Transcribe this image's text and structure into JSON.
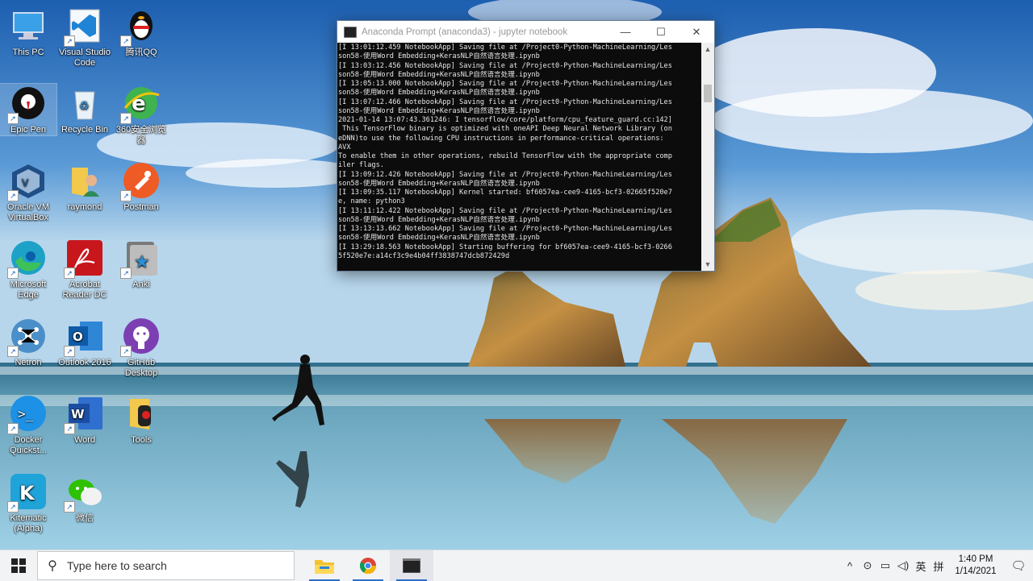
{
  "desktop": {
    "icons": [
      {
        "label": "This PC",
        "icon": "computer-icon"
      },
      {
        "label": "Visual Studio Code",
        "icon": "vscode-icon"
      },
      {
        "label": "腾讯QQ",
        "icon": "qq-penguin-icon"
      },
      {
        "label": "Epic Pen",
        "icon": "epic-pen-icon"
      },
      {
        "label": "Recycle Bin",
        "icon": "recycle-bin-icon"
      },
      {
        "label": "360安全浏览器",
        "icon": "360-browser-icon"
      },
      {
        "label": "Oracle VM VirtualBox",
        "icon": "virtualbox-icon"
      },
      {
        "label": "raymond",
        "icon": "user-folder-icon"
      },
      {
        "label": "Postman",
        "icon": "postman-icon"
      },
      {
        "label": "Microsoft Edge",
        "icon": "edge-icon"
      },
      {
        "label": "Acrobat Reader DC",
        "icon": "acrobat-icon"
      },
      {
        "label": "Anki",
        "icon": "anki-icon"
      },
      {
        "label": "Netron",
        "icon": "netron-icon"
      },
      {
        "label": "Outlook 2016",
        "icon": "outlook-icon"
      },
      {
        "label": "GitHub Desktop",
        "icon": "github-icon"
      },
      {
        "label": "Docker Quickst...",
        "icon": "docker-icon"
      },
      {
        "label": "Word",
        "icon": "word-icon"
      },
      {
        "label": "Tools",
        "icon": "tools-folder-icon"
      },
      {
        "label": "Kitematic (Alpha)",
        "icon": "kitematic-icon"
      },
      {
        "label": "微信",
        "icon": "wechat-icon"
      }
    ]
  },
  "window": {
    "title": "Anaconda Prompt (anaconda3) - jupyter  notebook",
    "minimize": "—",
    "maximize": "☐",
    "close": "✕",
    "console_lines": [
      "[I 13:01:12.459 NotebookApp] Saving file at /Project0-Python-MachineLearning/Les",
      "son58-使用Word Embedding+KerasNLP自然语言处理.ipynb",
      "[I 13:03:12.456 NotebookApp] Saving file at /Project0-Python-MachineLearning/Les",
      "son58-使用Word Embedding+KerasNLP自然语言处理.ipynb",
      "[I 13:05:13.000 NotebookApp] Saving file at /Project0-Python-MachineLearning/Les",
      "son58-使用Word Embedding+KerasNLP自然语言处理.ipynb",
      "[I 13:07:12.466 NotebookApp] Saving file at /Project0-Python-MachineLearning/Les",
      "son58-使用Word Embedding+KerasNLP自然语言处理.ipynb",
      "2021-01-14 13:07:43.361246: I tensorflow/core/platform/cpu_feature_guard.cc:142]",
      " This TensorFlow binary is optimized with oneAPI Deep Neural Network Library (on",
      "eDNN)to use the following CPU instructions in performance-critical operations:",
      "AVX",
      "To enable them in other operations, rebuild TensorFlow with the appropriate comp",
      "iler flags.",
      "[I 13:09:12.426 NotebookApp] Saving file at /Project0-Python-MachineLearning/Les",
      "son58-使用Word Embedding+KerasNLP自然语言处理.ipynb",
      "[I 13:09:35.117 NotebookApp] Kernel started: bf6057ea-cee9-4165-bcf3-02665f520e7",
      "e, name: python3",
      "[I 13:11:12.422 NotebookApp] Saving file at /Project0-Python-MachineLearning/Les",
      "son58-使用Word Embedding+KerasNLP自然语言处理.ipynb",
      "[I 13:13:13.662 NotebookApp] Saving file at /Project0-Python-MachineLearning/Les",
      "son58-使用Word Embedding+KerasNLP自然语言处理.ipynb",
      "[I 13:29:18.563 NotebookApp] Starting buffering for bf6057ea-cee9-4165-bcf3-0266",
      "5f520e7e:a14cf3c9e4b04ff3838747dcb872429d"
    ]
  },
  "taskbar": {
    "search_placeholder": "Type here to search",
    "apps": [
      "file-explorer-icon",
      "chrome-icon",
      "terminal-icon"
    ],
    "tray": {
      "chevron": "^",
      "ime": "英",
      "ime2": "拼",
      "time": "1:40 PM",
      "date": "1/14/2021"
    }
  },
  "colors": {
    "taskbar_accent": "#2c6fc5",
    "console_bg": "#0c0c0c"
  }
}
